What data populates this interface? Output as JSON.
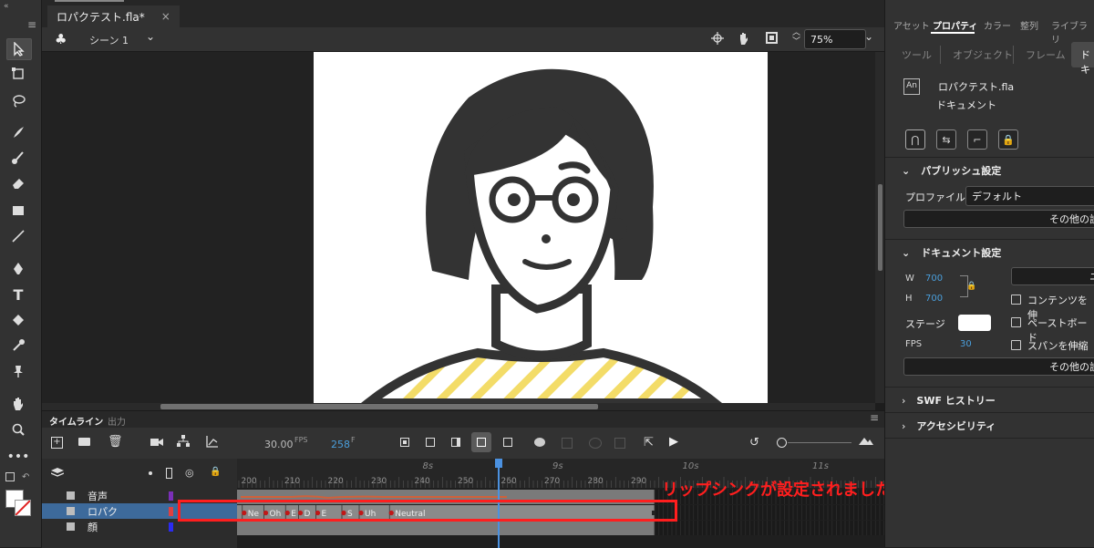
{
  "document": {
    "tab_title": "ロパクテスト.fla*",
    "close": "×"
  },
  "scene": {
    "label": "シーン 1",
    "zoom": "75%"
  },
  "timeline": {
    "tabs": [
      "タイムライン",
      "出力"
    ],
    "fps_value": "30.00",
    "fps_unit": "FPS",
    "frame_value": "258",
    "frame_unit": "F",
    "section_labels": [
      "8s",
      "9s",
      "10s",
      "11s"
    ],
    "frame_numbers": [
      "200",
      "210",
      "220",
      "230",
      "240",
      "250",
      "260",
      "270",
      "280",
      "290"
    ],
    "layers": [
      {
        "name": "音声",
        "color": "#7b2fb8"
      },
      {
        "name": "ロパク",
        "color": "#e04040"
      },
      {
        "name": "顔",
        "color": "#2b2bf0"
      }
    ],
    "lipsync_labels": [
      "Ne",
      "Oh",
      "E",
      "D",
      "E",
      "S",
      "Uh",
      "Neutral"
    ]
  },
  "annotation": {
    "text": "リップシンクが設定されました",
    "color": "#ff1e1e"
  },
  "right_panel": {
    "tabs": [
      "アセット",
      "プロパティ",
      "カラー",
      "整列",
      "ライブラリ"
    ],
    "subtabs": [
      "ツール",
      "オブジェクト",
      "フレーム",
      "ドキ"
    ],
    "file_badge": "An",
    "file_name": "ロパクテスト.fla",
    "file_type": "ドキュメント",
    "publish": {
      "title": "パブリッシュ設定",
      "profile_label": "プロファイル",
      "profile_value": "デフォルト",
      "more_button": "その他の設"
    },
    "doc_settings": {
      "title": "ドキュメント設定",
      "w_label": "W",
      "w_value": "700",
      "h_label": "H",
      "h_value": "700",
      "unit_button": "ニ",
      "fit_contents": "コンテンツを伸",
      "pasteboard": "ペーストボード",
      "stage_label": "ステージ",
      "fps_label": "FPS",
      "fps_value": "30",
      "span_stretch": "スパンを伸縮",
      "more_button": "その他の設"
    },
    "swf_history": "SWF ヒストリー",
    "accessibility": "アクセシビリティ"
  }
}
